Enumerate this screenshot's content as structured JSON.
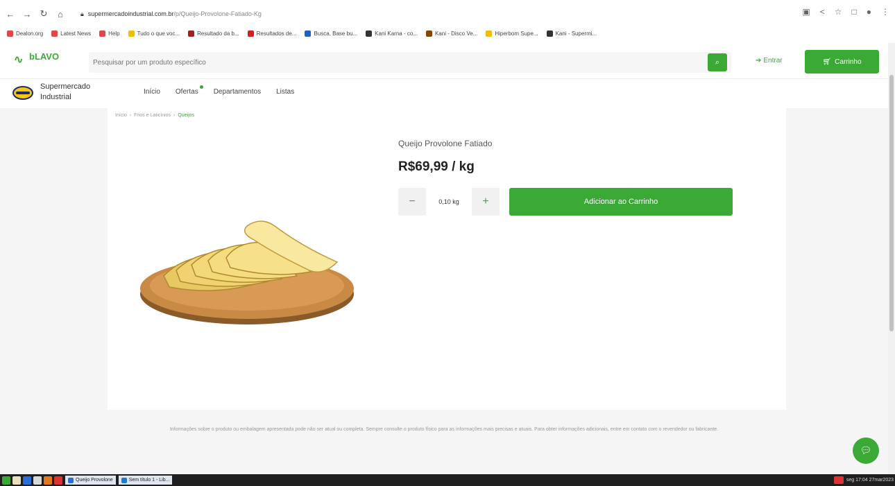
{
  "browser": {
    "url_host": "supermercadoindustrial.com.br",
    "url_path": "/p/Queijo-Provolone-Fatiado-Kg",
    "bookmarks": [
      {
        "label": "Dealon.org",
        "color": "#e04848"
      },
      {
        "label": "Latest News",
        "color": "#e04848"
      },
      {
        "label": "Help",
        "color": "#e04848"
      },
      {
        "label": "Tudo o que voc...",
        "color": "#f0c000"
      },
      {
        "label": "Resultado da b...",
        "color": "#a02020"
      },
      {
        "label": "Resultados de...",
        "color": "#d02020"
      },
      {
        "label": "Busca, Base bu...",
        "color": "#2060c0"
      },
      {
        "label": "Kani Karna - co...",
        "color": "#333333"
      },
      {
        "label": "Kani - Disco Ve...",
        "color": "#884400"
      },
      {
        "label": "Hiperbom Supe...",
        "color": "#f0c000"
      },
      {
        "label": "Kani - Supermi...",
        "color": "#333333"
      }
    ]
  },
  "site": {
    "search_placeholder": "Pesquisar por um produto específico",
    "login_label": "Entrar",
    "cart_label": "Carrinho",
    "accent": "#3aa935"
  },
  "store": {
    "name": "Supermercado Industrial",
    "menu": [
      "Início",
      "Ofertas",
      "Departamentos",
      "Listas"
    ]
  },
  "breadcrumb": [
    "Início",
    "Frios e Laticínios",
    "Queijos"
  ],
  "product": {
    "name": "Queijo Provolone Fatiado",
    "price": "R$69,99 / kg",
    "quantity": "0,10 kg",
    "add_label": "Adicionar ao Carrinho"
  },
  "disclaimer": "Informações sobre o produto ou embalagem apresentada pode não ser atual ou completa. Sempre consulte o produto físico para as informações mais precisas e atuais. Para obter informações adicionais, entre em contato com o revendedor ou fabricante.",
  "taskbar": {
    "tasks": [
      "Queijo Provolone",
      "Sem título 1 - Lib..."
    ],
    "clock": "seg 17:04 27mar2023"
  }
}
